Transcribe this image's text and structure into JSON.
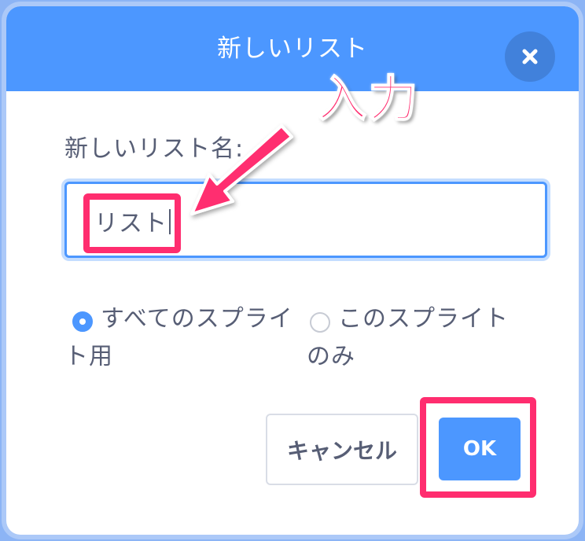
{
  "dialog": {
    "title": "新しいリスト",
    "close_icon": "close-icon",
    "field_label": "新しいリスト名:",
    "name_value": "リスト",
    "scope_options": [
      {
        "line1": "すべてのスプライ",
        "line2": "ト用",
        "selected": true
      },
      {
        "line1": "このスプライト",
        "line2": "のみ",
        "selected": false
      }
    ],
    "cancel_label": "キャンセル",
    "ok_label": "OK"
  },
  "annotation": {
    "label": "入力",
    "color": "#ff2d6f"
  },
  "colors": {
    "accent": "#4c97ff",
    "text": "#575e75",
    "backdrop": "#8cb4f5"
  }
}
